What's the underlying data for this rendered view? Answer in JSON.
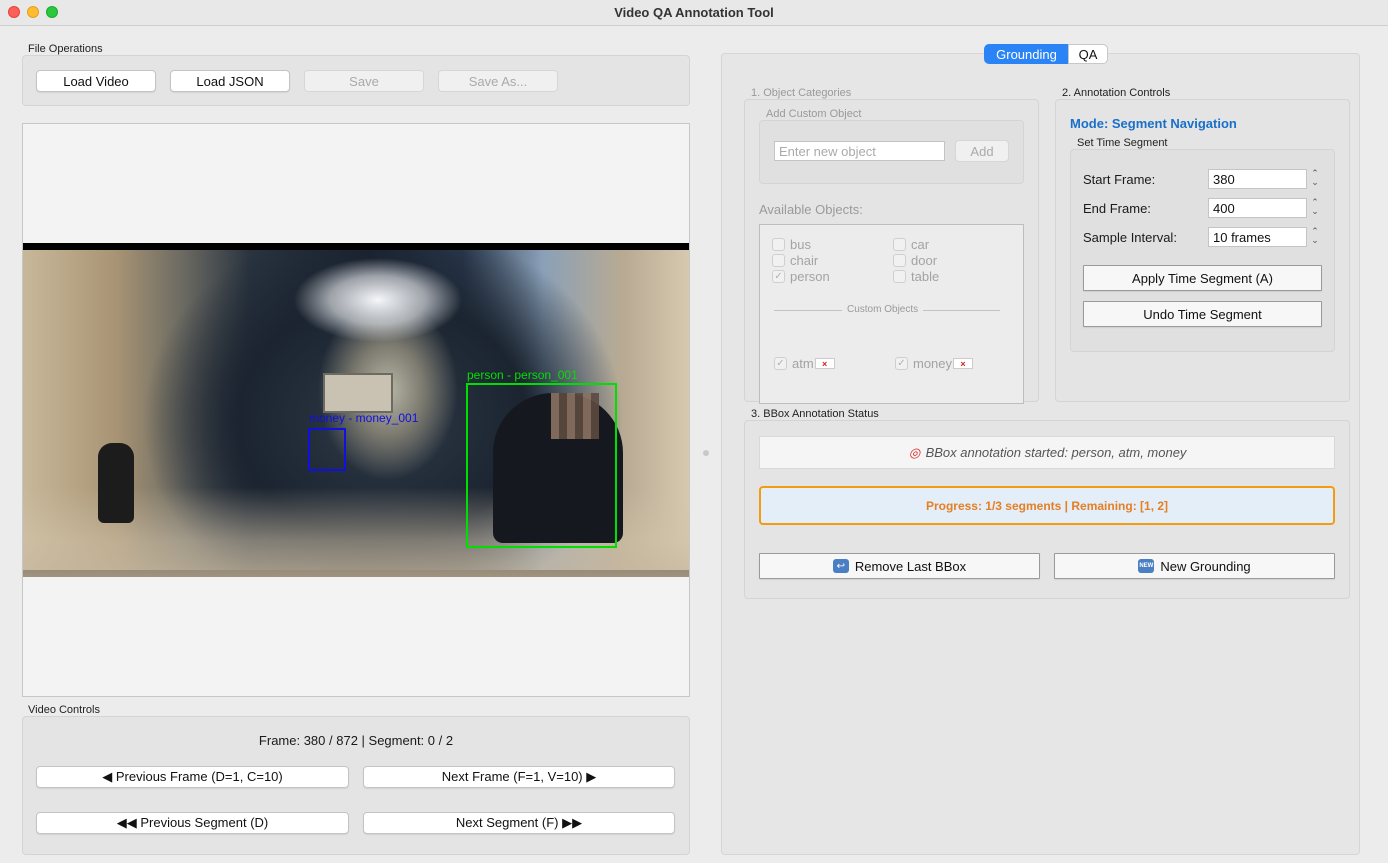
{
  "window": {
    "title": "Video QA Annotation Tool"
  },
  "file_ops": {
    "label": "File Operations",
    "load_video": "Load Video",
    "load_json": "Load JSON",
    "save": "Save",
    "save_as": "Save As..."
  },
  "video": {
    "bboxes": [
      {
        "label": "person - person_001",
        "color": "#00e000"
      },
      {
        "label": "money - money_001",
        "color": "#1010e0"
      }
    ]
  },
  "video_controls": {
    "label": "Video Controls",
    "frame_info": "Frame: 380 / 872 | Segment: 0 / 2",
    "prev_frame": "◀ Previous Frame (D=1, C=10)",
    "next_frame": "Next Frame (F=1, V=10) ▶",
    "prev_segment": "◀◀ Previous Segment (D)",
    "next_segment": "Next Segment (F) ▶▶"
  },
  "tabs": [
    {
      "label": "Grounding",
      "active": true
    },
    {
      "label": "QA",
      "active": false
    }
  ],
  "object_categories": {
    "label": "1. Object Categories",
    "custom_label": "Add Custom Object",
    "input_placeholder": "Enter new object",
    "add_button": "Add",
    "available_label": "Available Objects:",
    "items": [
      {
        "name": "bus",
        "checked": false
      },
      {
        "name": "car",
        "checked": false
      },
      {
        "name": "chair",
        "checked": false
      },
      {
        "name": "door",
        "checked": false
      },
      {
        "name": "person",
        "checked": true
      },
      {
        "name": "table",
        "checked": false
      }
    ],
    "custom_objects_label": "Custom Objects",
    "custom_items": [
      {
        "name": "atm",
        "checked": true,
        "remove": "×"
      },
      {
        "name": "money",
        "checked": true,
        "remove": "×"
      }
    ]
  },
  "annotation_controls": {
    "label": "2. Annotation Controls",
    "mode": "Mode: Segment Navigation",
    "set_time_label": "Set Time Segment",
    "start_frame_label": "Start Frame:",
    "start_frame": "380",
    "end_frame_label": "End Frame:",
    "end_frame": "400",
    "sample_interval_label": "Sample Interval:",
    "sample_interval": "10 frames",
    "apply_button": "Apply Time Segment (A)",
    "undo_button": "Undo Time Segment"
  },
  "bbox_status": {
    "label": "3. BBox Annotation Status",
    "status": "BBox annotation started: person, atm, money",
    "progress": "Progress: 1/3 segments | Remaining: [1, 2]",
    "remove_last": "Remove Last BBox",
    "new_grounding": "New Grounding",
    "new_badge": "NEW"
  },
  "colors": {
    "accent": "#2a84f6",
    "mode_text": "#1a6fc9",
    "progress_border": "#f39c12",
    "progress_bg": "#e3eef9"
  }
}
